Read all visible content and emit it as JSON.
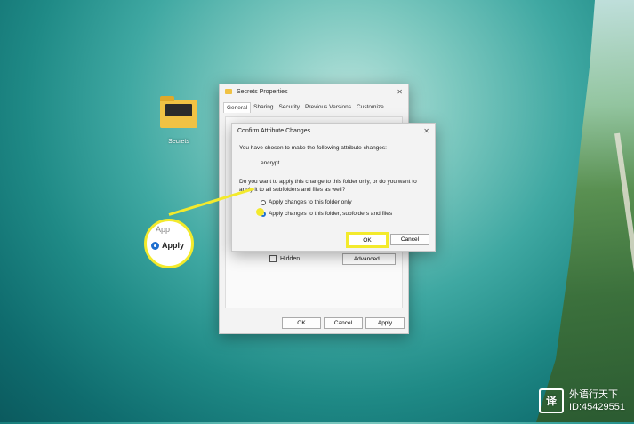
{
  "desktop": {
    "folder_label": "Secrets"
  },
  "properties_window": {
    "title": "Secrets Properties",
    "close_glyph": "✕",
    "tabs": [
      "General",
      "Sharing",
      "Security",
      "Previous Versions",
      "Customize"
    ],
    "hidden_label": "Hidden",
    "advanced_label": "Advanced...",
    "ok_label": "OK",
    "cancel_label": "Cancel",
    "apply_label": "Apply"
  },
  "confirm_dialog": {
    "title": "Confirm Attribute Changes",
    "close_glyph": "✕",
    "intro": "You have chosen to make the following attribute changes:",
    "change": "encrypt",
    "question": "Do you want to apply this change to this folder only, or do you want to apply it to all subfolders and files as well?",
    "option_folder_only": "Apply changes to this folder only",
    "option_all": "Apply changes to this folder, subfolders and files",
    "selected_option": "option_all",
    "ok_label": "OK",
    "cancel_label": "Cancel"
  },
  "callout": {
    "peek_text": "App",
    "apply_text": "Apply"
  },
  "watermark": {
    "logo_glyph": "译",
    "name": "外语行天下",
    "id": "ID:45429551"
  },
  "colors": {
    "highlight": "#f3ea2c",
    "radio_accent": "#1f6fcf"
  }
}
